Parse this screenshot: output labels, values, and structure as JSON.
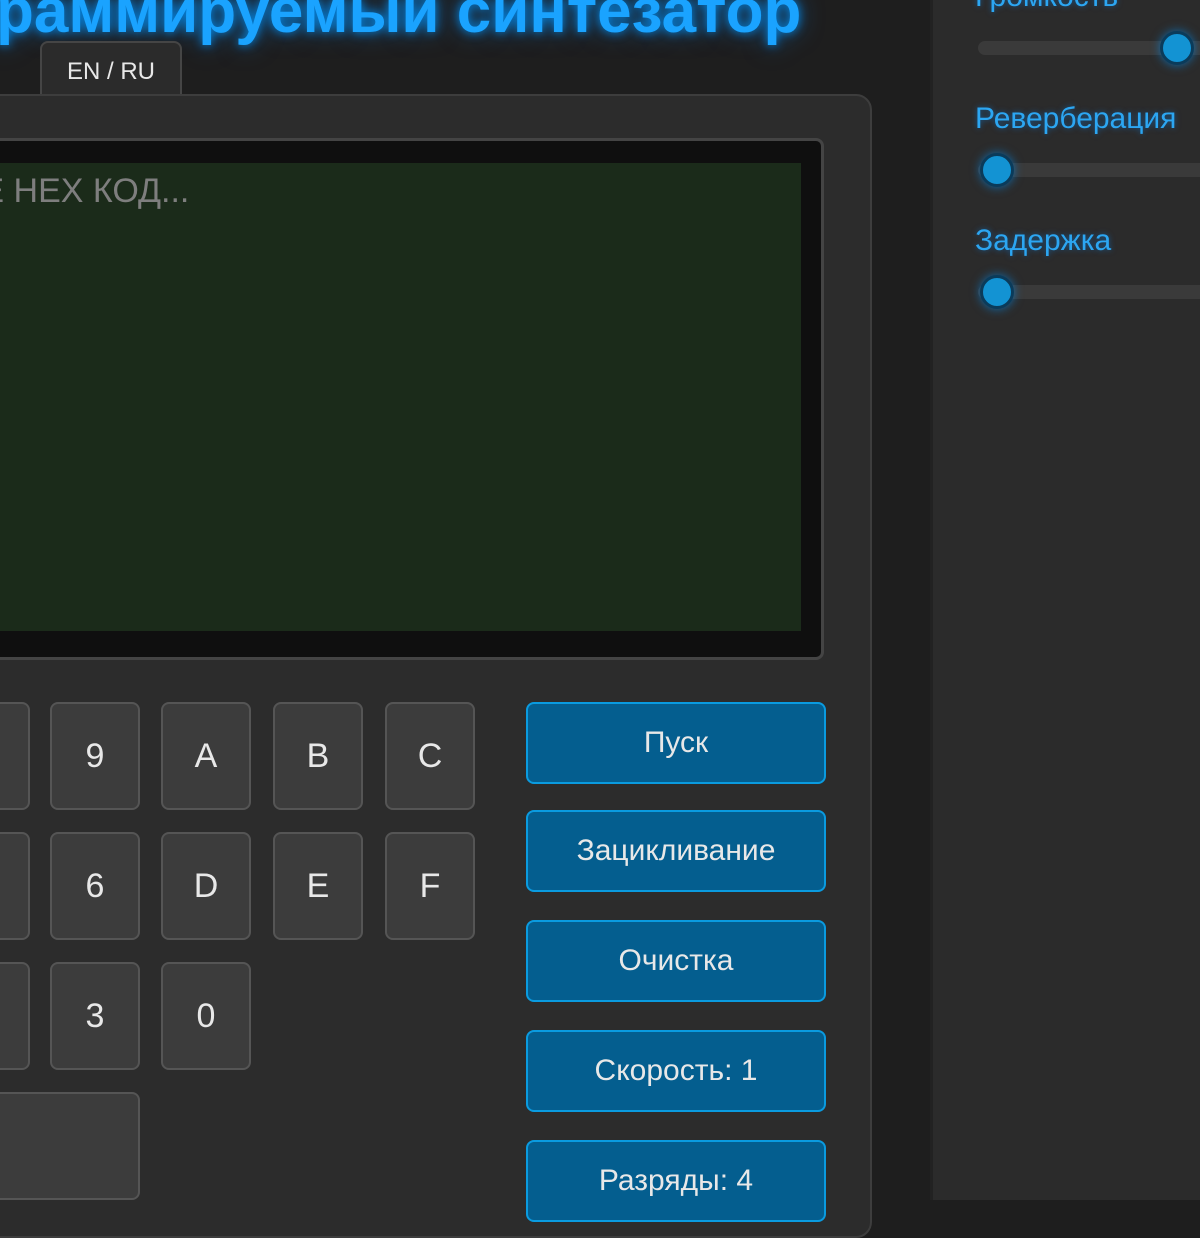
{
  "header": {
    "title": "раммируемый синтезатор",
    "language_toggle": "EN / RU"
  },
  "display": {
    "placeholder": "ГЕ НЕХ КОД..."
  },
  "keypad": {
    "row1": [
      "9",
      "A",
      "B",
      "C"
    ],
    "row2": [
      "6",
      "D",
      "E",
      "F"
    ],
    "row3": [
      "3",
      "0"
    ],
    "partial_key": "]"
  },
  "controls": {
    "play": "Пуск",
    "loop": "Зацикливание",
    "clear": "Очистка",
    "speed": "Скорость: 1",
    "digits": "Разряды: 4"
  },
  "sliders": [
    {
      "label": "Громкость",
      "value_pct": 100
    },
    {
      "label": "Реверберация",
      "value_pct": 0
    },
    {
      "label": "Задержка",
      "value_pct": 0
    }
  ],
  "colors": {
    "accent": "#1aa3ff",
    "button_fill": "#045e8f",
    "screen": "#1b2b1a",
    "background": "#1e1e1e"
  },
  "icons": [
    "slider-thumb"
  ]
}
